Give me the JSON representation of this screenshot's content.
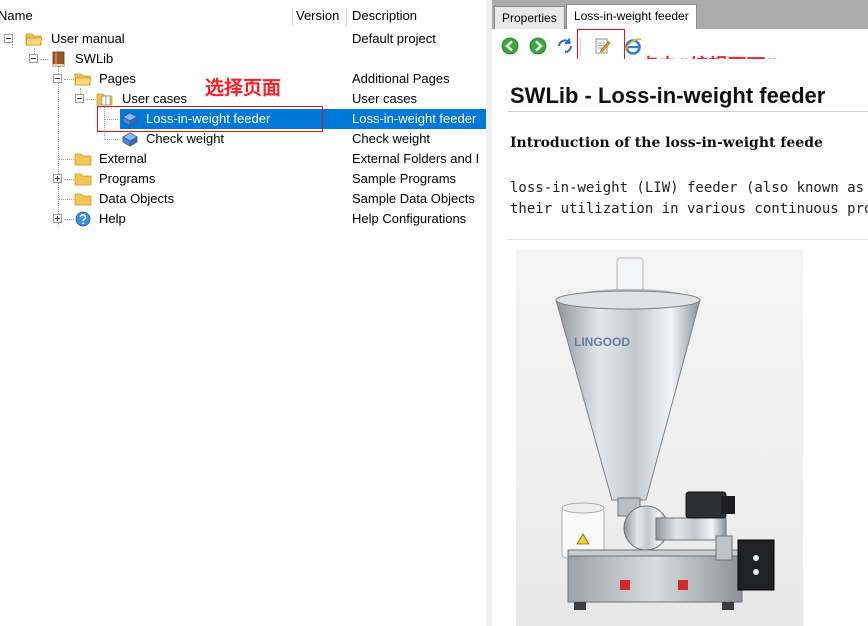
{
  "tree": {
    "columns": {
      "name": "Name",
      "version": "Version",
      "description": "Description"
    },
    "rows": [
      {
        "name": "User manual",
        "description": "Default project"
      },
      {
        "name": "SWLib",
        "description": ""
      },
      {
        "name": "Pages",
        "description": "Additional Pages"
      },
      {
        "name": "User cases",
        "description": "User cases"
      },
      {
        "name": "Loss-in-weight feeder",
        "description": "Loss-in-weight feeder"
      },
      {
        "name": "Check weight",
        "description": "Check weight"
      },
      {
        "name": "External",
        "description": "External Folders and I"
      },
      {
        "name": "Programs",
        "description": "Sample Programs"
      },
      {
        "name": "Data Objects",
        "description": "Sample Data Objects"
      },
      {
        "name": "Help",
        "description": "Help Configurations"
      }
    ],
    "annotation_select_page": "选择页面"
  },
  "doc": {
    "tabs": {
      "properties": "Properties",
      "active": "Loss-in-weight feeder"
    },
    "annotation_edit_page": "点击“编辑页面”",
    "title": "SWLib - Loss-in-weight feeder",
    "subtitle": "Introduction of the loss-in-weight feede",
    "para_line1": "loss-in-weight (LIW) feeder (also known as",
    "para_line2": "their utilization in various continuous produc",
    "image_logo_text": "LINGOOD"
  },
  "colors": {
    "selection": "#0078d7",
    "annotation": "#ff1c24",
    "tab_strip": "#ababab"
  }
}
